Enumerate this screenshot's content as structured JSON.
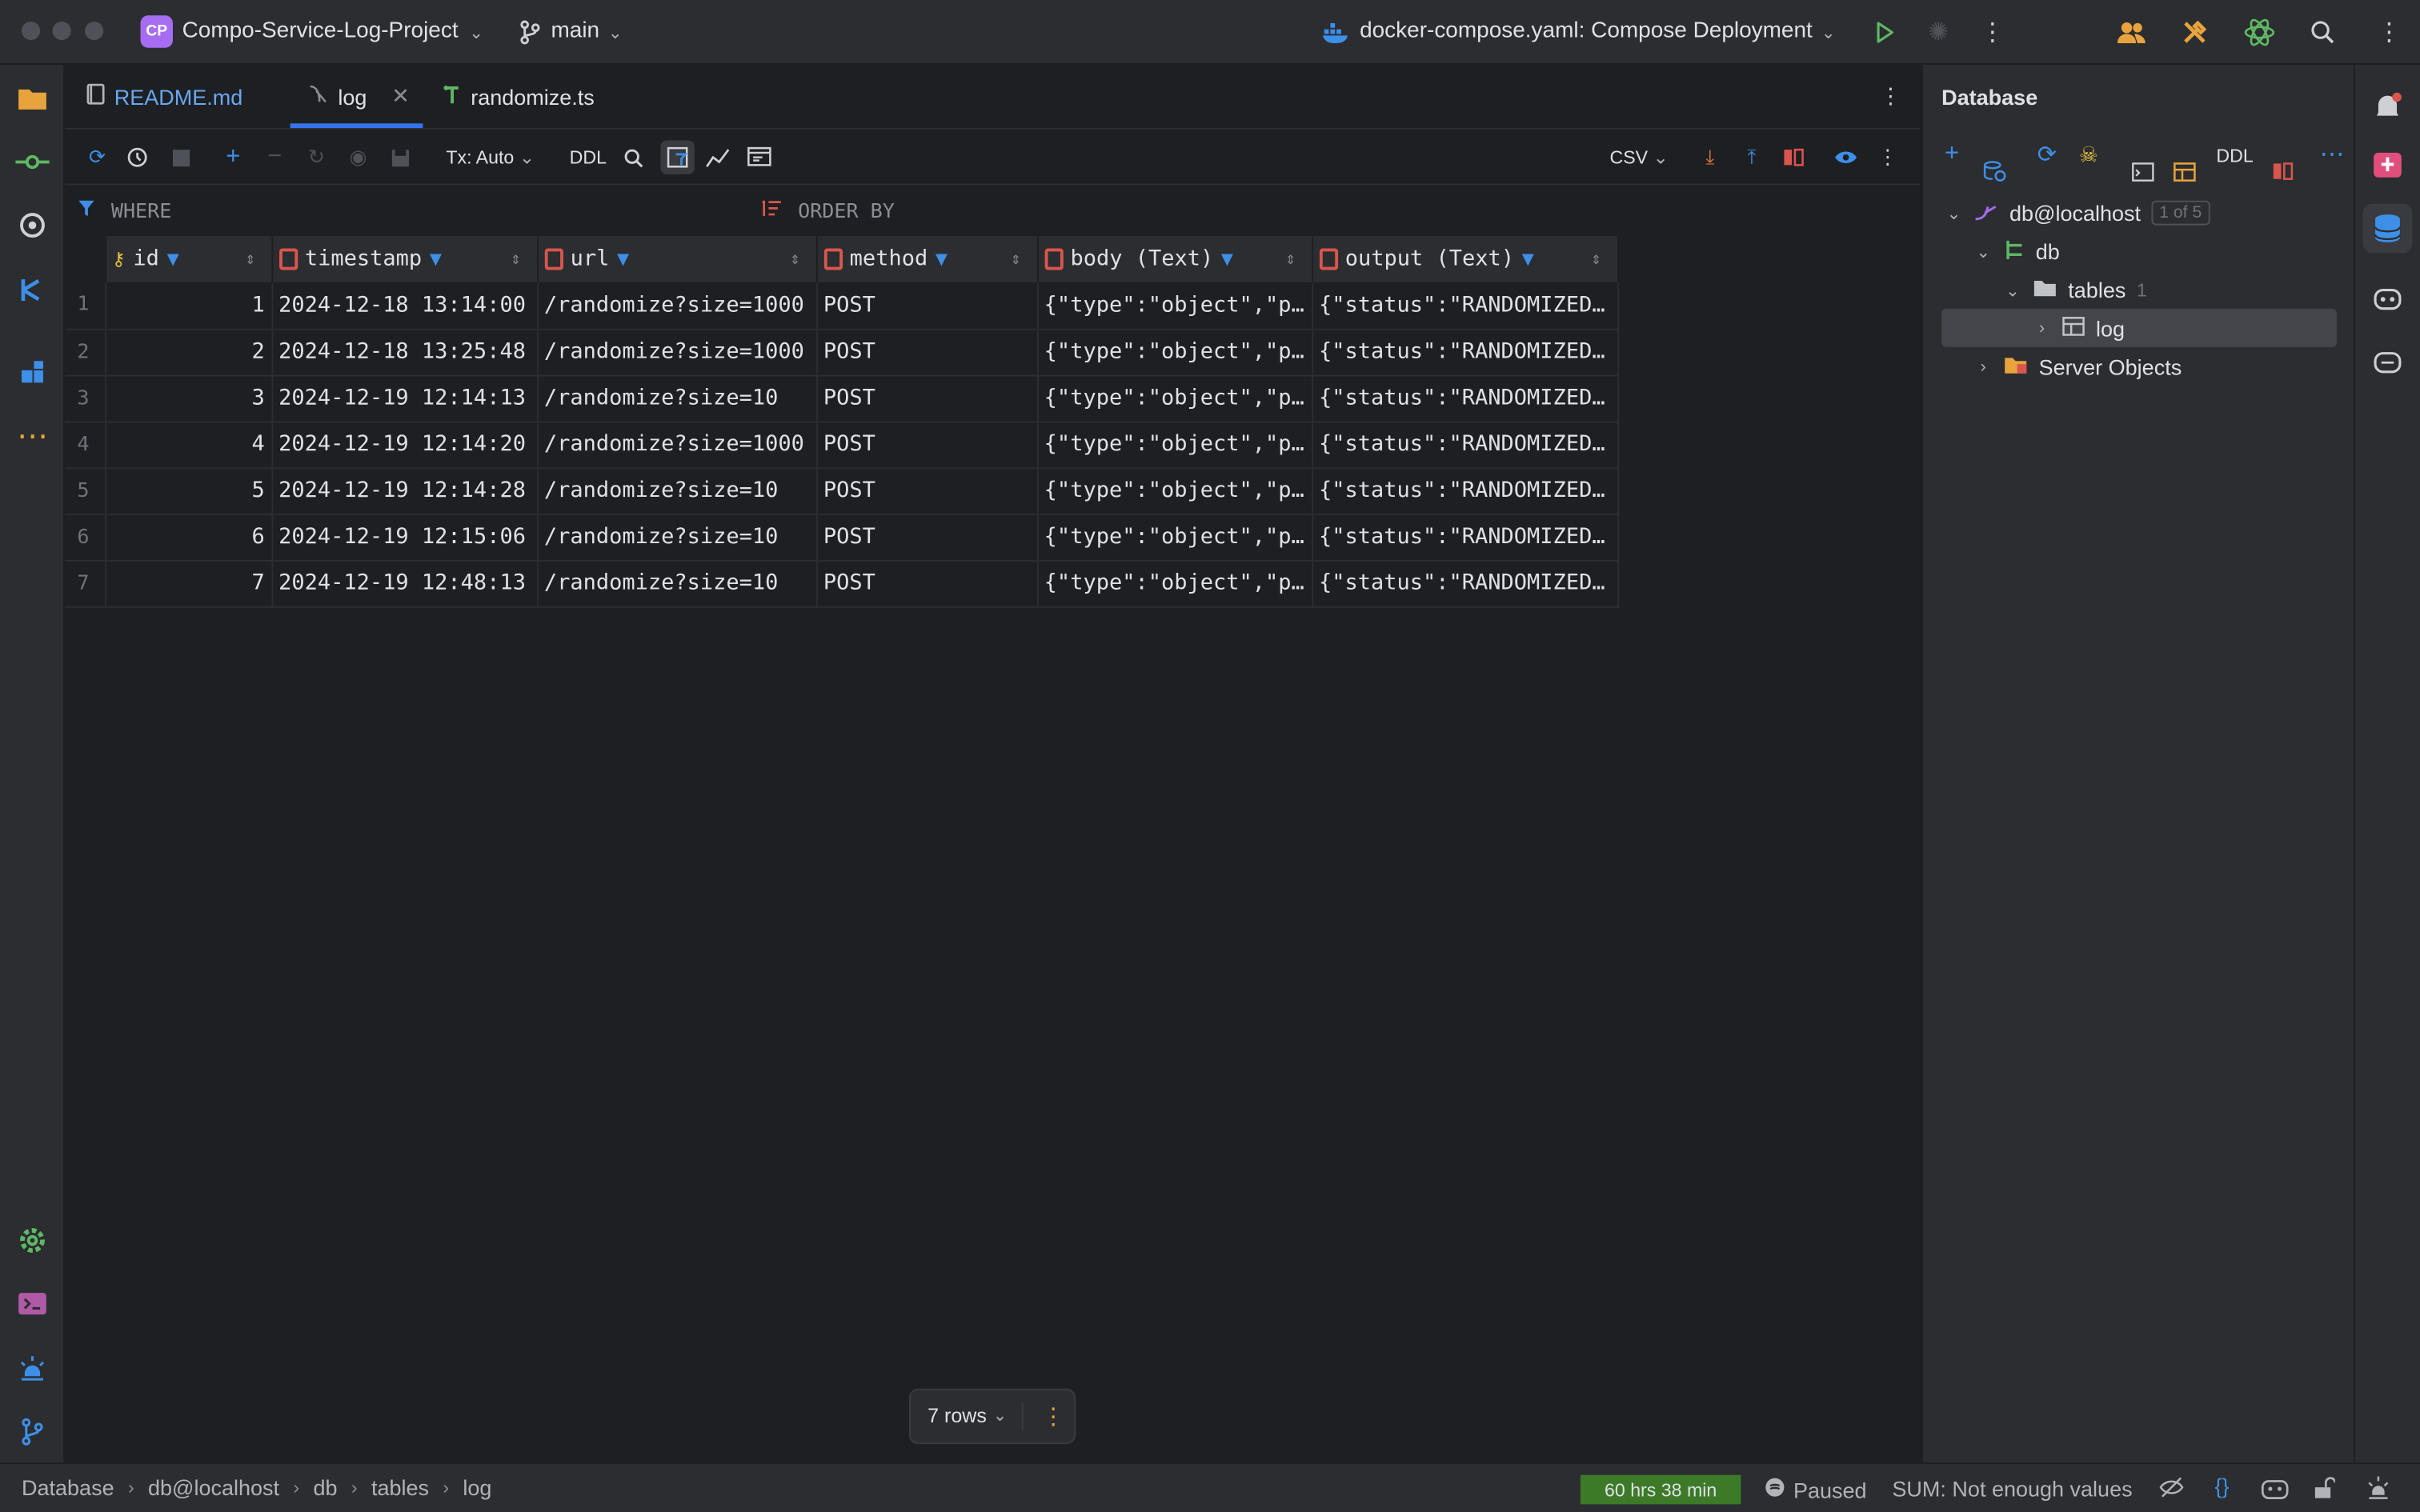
{
  "titlebar": {
    "project_badge": "CP",
    "project_name": "Compo-Service-Log-Project",
    "branch": "main",
    "run_config": "docker-compose.yaml: Compose Deployment"
  },
  "tabs": [
    {
      "label": "README.md"
    },
    {
      "label": "log"
    },
    {
      "label": "randomize.ts"
    }
  ],
  "data_toolbar": {
    "tx_mode": "Tx: Auto",
    "ddl": "DDL",
    "export_format": "CSV"
  },
  "filters": {
    "where": "WHERE",
    "order_by": "ORDER BY"
  },
  "table": {
    "columns": [
      "id",
      "timestamp",
      "url",
      "method",
      "body (Text)",
      "output (Text)"
    ],
    "rows": [
      {
        "rn": "1",
        "id": "1",
        "timestamp": "2024-12-18 13:14:00",
        "url": "/randomize?size=1000",
        "method": "POST",
        "body": "{\"type\":\"object\",\"p…",
        "output": "{\"status\":\"RANDOMIZED…"
      },
      {
        "rn": "2",
        "id": "2",
        "timestamp": "2024-12-18 13:25:48",
        "url": "/randomize?size=1000",
        "method": "POST",
        "body": "{\"type\":\"object\",\"p…",
        "output": "{\"status\":\"RANDOMIZED…"
      },
      {
        "rn": "3",
        "id": "3",
        "timestamp": "2024-12-19 12:14:13",
        "url": "/randomize?size=10",
        "method": "POST",
        "body": "{\"type\":\"object\",\"p…",
        "output": "{\"status\":\"RANDOMIZED…"
      },
      {
        "rn": "4",
        "id": "4",
        "timestamp": "2024-12-19 12:14:20",
        "url": "/randomize?size=1000",
        "method": "POST",
        "body": "{\"type\":\"object\",\"p…",
        "output": "{\"status\":\"RANDOMIZED…"
      },
      {
        "rn": "5",
        "id": "5",
        "timestamp": "2024-12-19 12:14:28",
        "url": "/randomize?size=10",
        "method": "POST",
        "body": "{\"type\":\"object\",\"p…",
        "output": "{\"status\":\"RANDOMIZED…"
      },
      {
        "rn": "6",
        "id": "6",
        "timestamp": "2024-12-19 12:15:06",
        "url": "/randomize?size=10",
        "method": "POST",
        "body": "{\"type\":\"object\",\"p…",
        "output": "{\"status\":\"RANDOMIZED…"
      },
      {
        "rn": "7",
        "id": "7",
        "timestamp": "2024-12-19 12:48:13",
        "url": "/randomize?size=10",
        "method": "POST",
        "body": "{\"type\":\"object\",\"p…",
        "output": "{\"status\":\"RANDOMIZED…"
      }
    ]
  },
  "rows_pill": {
    "label": "7 rows"
  },
  "database_panel": {
    "title": "Database",
    "ddl": "DDL",
    "tree": {
      "datasource": "db@localhost",
      "datasource_badge": "1 of 5",
      "schema": "db",
      "tables_folder": "tables",
      "tables_count": "1",
      "table": "log",
      "server_objects": "Server Objects"
    }
  },
  "statusbar": {
    "breadcrumbs": [
      "Database",
      "db@localhost",
      "db",
      "tables",
      "log"
    ],
    "timer": "60 hrs 38 min",
    "paused": "Paused",
    "sum": "SUM: Not enough values"
  },
  "colors": {
    "accent": "#3574f0",
    "timer_bg": "#3c7a28",
    "badge": "#a66cf1"
  }
}
